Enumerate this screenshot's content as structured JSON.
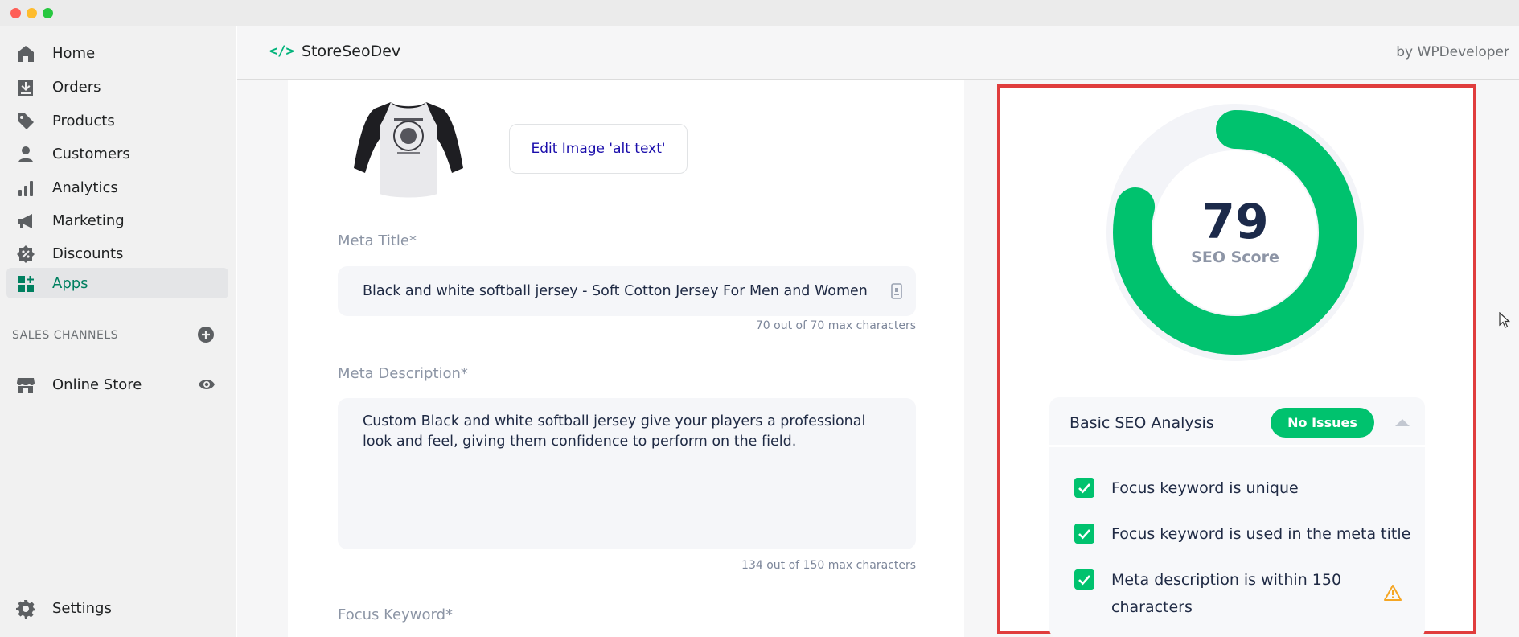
{
  "window": {
    "controls": [
      "close",
      "minimize",
      "zoom"
    ]
  },
  "sidebar": {
    "items": [
      {
        "label": "Home",
        "icon": "home-icon"
      },
      {
        "label": "Orders",
        "icon": "orders-icon"
      },
      {
        "label": "Products",
        "icon": "tag-icon"
      },
      {
        "label": "Customers",
        "icon": "person-icon"
      },
      {
        "label": "Analytics",
        "icon": "bar-chart-icon"
      },
      {
        "label": "Marketing",
        "icon": "megaphone-icon"
      },
      {
        "label": "Discounts",
        "icon": "discount-icon"
      },
      {
        "label": "Apps",
        "icon": "apps-icon",
        "active": true
      }
    ],
    "sales_channels_title": "SALES CHANNELS",
    "online_store": {
      "label": "Online Store",
      "icon": "store-icon"
    },
    "settings": {
      "label": "Settings",
      "icon": "gear-icon"
    }
  },
  "header": {
    "brand_icon": "</>",
    "app_name": "StoreSeoDev",
    "byline": "by WPDeveloper"
  },
  "editor": {
    "alt_text_button": "Edit Image 'alt text'",
    "meta_title": {
      "label": "Meta Title*",
      "value": "Black and white softball jersey - Soft Cotton Jersey For Men and Women",
      "counter": "70 out of 70 max characters"
    },
    "meta_description": {
      "label": "Meta Description*",
      "value": "Custom Black and white softball jersey give your players a professional look and feel, giving them confidence to perform on the field.",
      "counter": "134 out of 150 max characters"
    },
    "focus_keyword": {
      "label": "Focus Keyword*"
    }
  },
  "seo": {
    "score": "79",
    "score_fraction": 0.79,
    "score_label": "SEO Score",
    "colors": {
      "accent": "#00c26e",
      "track": "#eef0f5",
      "highlight_border": "#e03d3d"
    },
    "analysis": {
      "title": "Basic SEO Analysis",
      "badge": "No Issues",
      "checks": [
        {
          "text": "Focus keyword is unique",
          "checked": true
        },
        {
          "text": "Focus keyword is used in the meta title",
          "checked": true
        },
        {
          "text_line1": "Meta description is within 150",
          "text_line2": "characters",
          "checked": true,
          "warning": true
        }
      ]
    }
  }
}
